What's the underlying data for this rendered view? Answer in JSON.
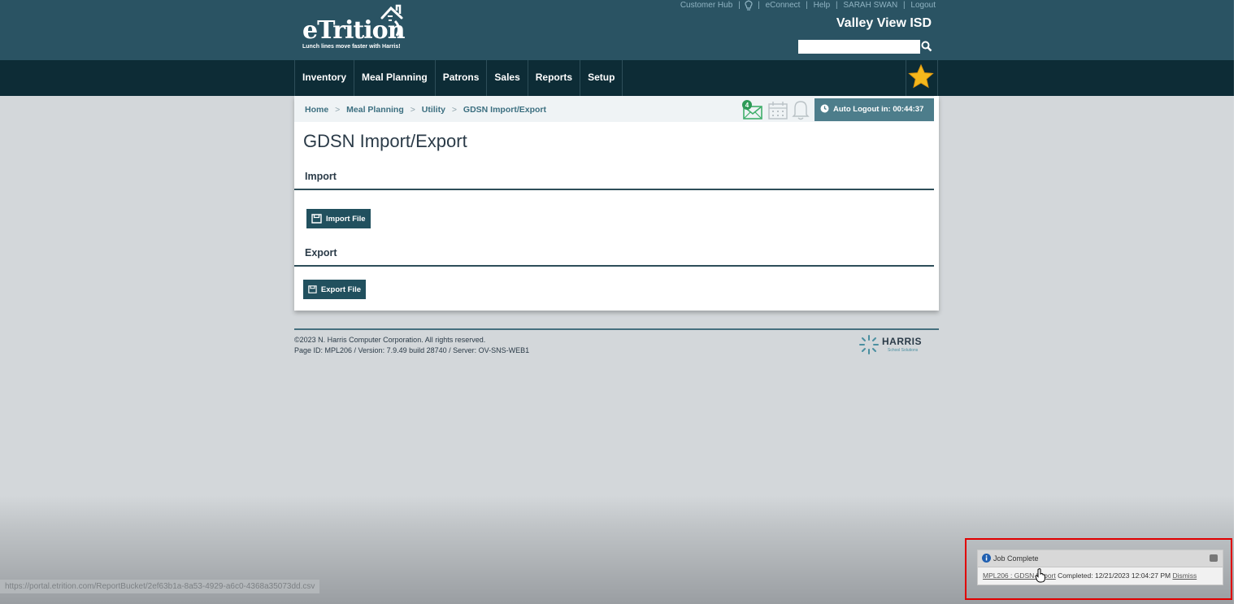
{
  "header": {
    "logo_text": "eTrition",
    "logo_tagline": "Lunch lines move faster with Harris!",
    "top_links": [
      "Customer Hub",
      "eConnect",
      "Help",
      "SARAH SWAN",
      "Logout"
    ],
    "district": "Valley View ISD",
    "search": {
      "value": "",
      "placeholder": ""
    }
  },
  "nav": {
    "items": [
      "Inventory",
      "Meal Planning",
      "Patrons",
      "Sales",
      "Reports",
      "Setup"
    ]
  },
  "breadcrumb": [
    "Home",
    "Meal Planning",
    "Utility",
    "GDSN Import/Export"
  ],
  "breadcrumb_separator": ">",
  "notifications": {
    "mail_count": "4"
  },
  "auto_logout": "Auto Logout in: 00:44:37",
  "page": {
    "title": "GDSN Import/Export",
    "import_heading": "Import",
    "import_button": "Import File",
    "export_heading": "Export",
    "export_button": "Export File"
  },
  "footer": {
    "copyright": "©2023 N. Harris Computer Corporation. All rights reserved.",
    "page_id": "Page ID: MPL206 / Version: 7.9.49 build 28740 / Server: OV-SNS-WEB1",
    "company": "HARRIS",
    "company_sub": "School Solutions"
  },
  "status_url": "https://portal.etrition.com/ReportBucket/2ef63b1a-8a53-4929-a6c0-4368a35073dd.csv",
  "toast": {
    "title": "Job Complete",
    "job_link": "MPL206 : GDSN Import",
    "message": "Completed: 12/21/2023 12:04:27 PM",
    "dismiss": "Dismiss"
  },
  "colors": {
    "header": "#2a5363",
    "nav": "#0d2c36",
    "button": "#21505e",
    "highlight": "#e00000"
  }
}
